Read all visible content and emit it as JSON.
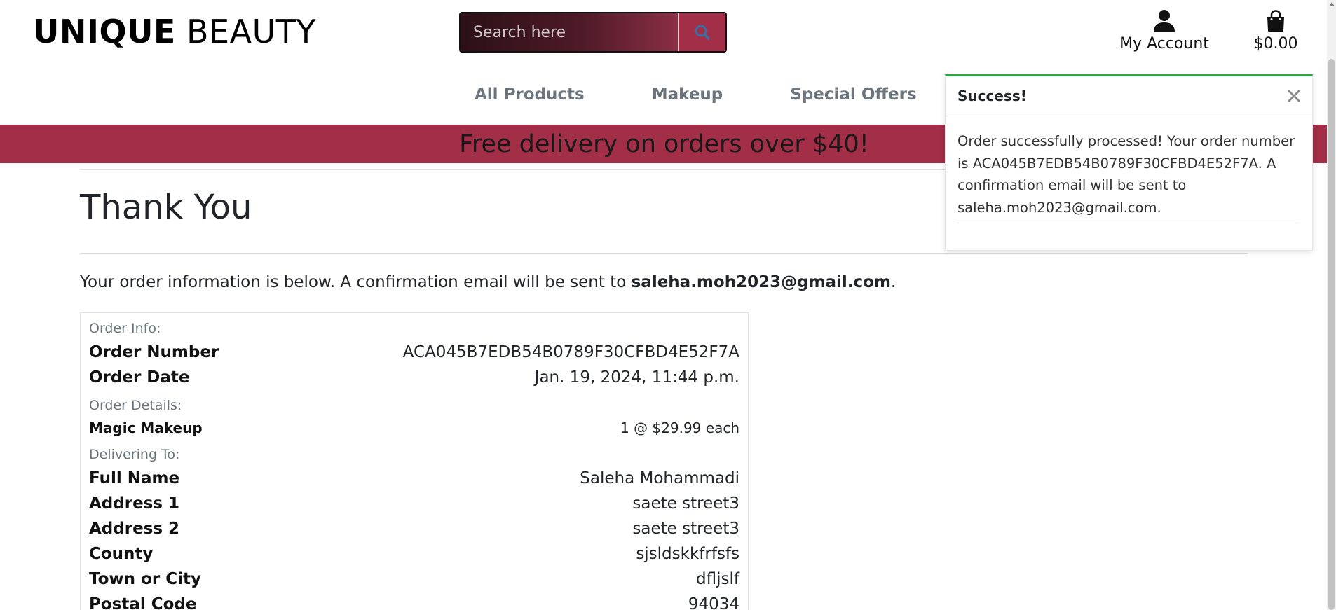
{
  "header": {
    "logo_bold": "UNIQUE",
    "logo_light": "BEAUTY",
    "search_placeholder": "Search here",
    "account_label": "My Account",
    "cart_total": "$0.00"
  },
  "icons": {
    "search": "search-icon",
    "account": "user-icon",
    "bag": "shopping-bag-icon",
    "close": "close-icon"
  },
  "colors": {
    "accent": "#a32e48",
    "success": "#28a745",
    "muted": "#6c757d"
  },
  "nav": {
    "items": [
      {
        "label": "All Products"
      },
      {
        "label": "Makeup"
      },
      {
        "label": "Special Offers"
      }
    ]
  },
  "banner": {
    "text": "Free delivery on orders over $40!"
  },
  "main": {
    "title": "Thank You",
    "lead_prefix": "Your order information is below. A confirmation email will be sent to ",
    "lead_email": "saleha.moh2023@gmail.com",
    "lead_suffix": "."
  },
  "order": {
    "info_label": "Order Info:",
    "order_number_label": "Order Number",
    "order_number": "ACA045B7EDB54B0789F30CFBD4E52F7A",
    "order_date_label": "Order Date",
    "order_date": "Jan. 19, 2024, 11:44 p.m.",
    "details_label": "Order Details:",
    "items": [
      {
        "name": "Magic Makeup",
        "qty_price": "1 @ $29.99 each"
      }
    ],
    "delivering_label": "Delivering To:",
    "delivery": [
      {
        "label": "Full Name",
        "value": "Saleha Mohammadi"
      },
      {
        "label": "Address 1",
        "value": "saete street3"
      },
      {
        "label": "Address 2",
        "value": "saete street3"
      },
      {
        "label": "County",
        "value": "sjsldskkfrfsfs"
      },
      {
        "label": "Town or City",
        "value": "dfljslf"
      },
      {
        "label": "Postal Code",
        "value": "94034"
      }
    ]
  },
  "toast": {
    "title": "Success!",
    "message": "Order successfully processed! Your order number is ACA045B7EDB54B0789F30CFBD4E52F7A. A confirmation email will be sent to saleha.moh2023@gmail.com."
  }
}
